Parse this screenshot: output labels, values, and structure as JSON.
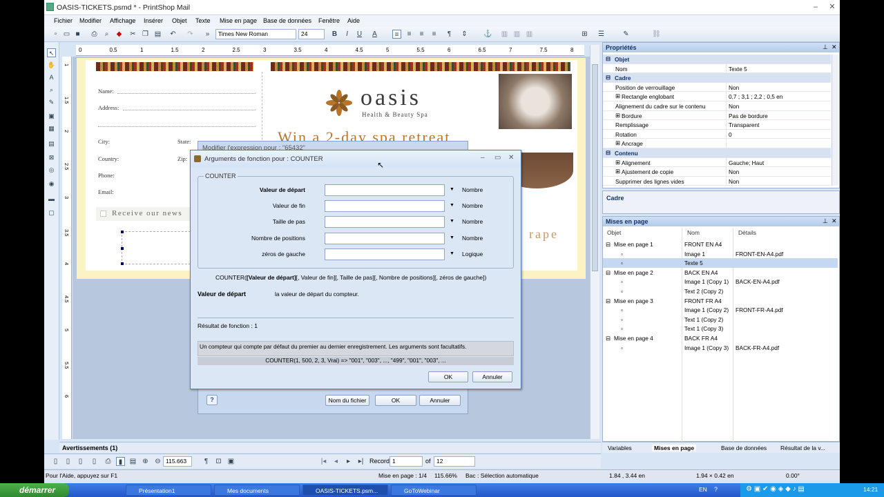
{
  "window": {
    "title": "OASIS-TICKETS.psmd * - PrintShop Mail"
  },
  "menu": [
    "Fichier",
    "Modifier",
    "Affichage",
    "Insérer",
    "Objet",
    "Texte",
    "Mise en page",
    "Base de données",
    "Fenêtre",
    "Aide"
  ],
  "toolbar": {
    "font": "Times New Roman",
    "size": "24",
    "zoom": "115.663"
  },
  "ruler": {
    "h_ticks": [
      "0",
      "0.5",
      "1",
      "1.5",
      "2",
      "2.5",
      "3",
      "3.5",
      "4",
      "4.5",
      "5",
      "5.5",
      "6",
      "6.5",
      "7",
      "7.5",
      "8"
    ],
    "v_ticks": [
      "1",
      "1.5",
      "2",
      "2.5",
      "3",
      "3.5",
      "4",
      "4.5",
      "5",
      "5.5",
      "6"
    ]
  },
  "document": {
    "form": {
      "name": "Name:",
      "address": "Address:",
      "city": "City:",
      "state": "State:",
      "country": "Country:",
      "zip": "Zip:",
      "phone": "Phone:",
      "email": "Email:",
      "receive": "Receive our news"
    },
    "brand": {
      "name": "oasis",
      "tagline": "Health & Beauty Spa",
      "headline": "Win a 2-day spa retreat",
      "fragment": "rape"
    }
  },
  "dialog_back": {
    "title": "Modifier l'expression pour : \"65432\"",
    "help_label": "?",
    "file_button": "Nom du fichier",
    "ok": "OK",
    "cancel": "Annuler"
  },
  "dialog": {
    "title": "Arguments de fonction pour : COUNTER",
    "group": "COUNTER",
    "fields": [
      {
        "label": "Valeur de départ",
        "type": "Nombre",
        "bold": true
      },
      {
        "label": "Valeur de fin",
        "type": "Nombre"
      },
      {
        "label": "Taille de pas",
        "type": "Nombre"
      },
      {
        "label": "Nombre de positions",
        "type": "Nombre"
      },
      {
        "label": "zéros de gauche",
        "type": "Logique"
      }
    ],
    "syntax_prefix": "COUNTER(",
    "syntax_bold": "[Valeur de départ]",
    "syntax_rest": "[, Valeur de fin][, Taille de pas][, Nombre de positions][, zéros de gauche])",
    "arg_name": "Valeur de départ",
    "arg_desc": "la valeur de départ du compteur.",
    "result": "Résultat de fonction : 1",
    "description": "Un compteur qui compte par défaut du premier au dernier enregistrement. Les arguments sont facultatifs.",
    "example": "COUNTER(1, 500, 2, 3, Vrai) => \"001\", \"003\", ..., \"499\", \"001\", \"003\", ...",
    "ok": "OK",
    "cancel": "Annuler"
  },
  "properties": {
    "title": "Propriétés",
    "rows": [
      {
        "k": "Objet",
        "v": "",
        "grp": true
      },
      {
        "k": "Nom",
        "v": "Texte 5"
      },
      {
        "k": "Cadre",
        "v": "",
        "grp": true
      },
      {
        "k": "Position de verrouillage",
        "v": "Non"
      },
      {
        "k": "Rectangle englobant",
        "v": "0,7 ; 3,1 ; 2,2 ; 0,5 en",
        "exp": true
      },
      {
        "k": "Alignement du cadre sur le contenu",
        "v": "Non"
      },
      {
        "k": "Bordure",
        "v": "Pas de bordure",
        "exp": true
      },
      {
        "k": "Remplissage",
        "v": "Transparent"
      },
      {
        "k": "Rotation",
        "v": "0"
      },
      {
        "k": "Ancrage",
        "v": "",
        "exp": true
      },
      {
        "k": "Contenu",
        "v": "",
        "grp": true
      },
      {
        "k": "Alignement",
        "v": "Gauche; Haut",
        "exp": true
      },
      {
        "k": "Ajustement de copie",
        "v": "Non",
        "exp": true
      },
      {
        "k": "Supprimer des lignes vides",
        "v": "Non"
      }
    ],
    "footer": "Cadre"
  },
  "mises": {
    "title": "Mises en page",
    "headers": [
      "Objet",
      "Nom",
      "Détails"
    ],
    "rows": [
      {
        "o": "Mise en page 1",
        "n": "FRONT EN A4",
        "d": "",
        "lvl": 0
      },
      {
        "o": "",
        "n": "Image 1",
        "d": "FRONT-EN-A4.pdf",
        "lvl": 1
      },
      {
        "o": "",
        "n": "Texte 5",
        "d": "",
        "lvl": 1,
        "sel": true
      },
      {
        "o": "Mise en page 2",
        "n": "BACK EN A4",
        "d": "",
        "lvl": 0
      },
      {
        "o": "",
        "n": "Image 1 (Copy 1)",
        "d": "BACK-EN-A4.pdf",
        "lvl": 1
      },
      {
        "o": "",
        "n": "Text 2 (Copy 2)",
        "d": "",
        "lvl": 1
      },
      {
        "o": "Mise en page 3",
        "n": "FRONT FR A4",
        "d": "",
        "lvl": 0
      },
      {
        "o": "",
        "n": "Image 1 (Copy 2)",
        "d": "FRONT-FR-A4.pdf",
        "lvl": 1
      },
      {
        "o": "",
        "n": "Text 1 (Copy 2)",
        "d": "",
        "lvl": 1
      },
      {
        "o": "",
        "n": "Text 1 (Copy 3)",
        "d": "",
        "lvl": 1
      },
      {
        "o": "Mise en page 4",
        "n": "BACK FR A4",
        "d": "",
        "lvl": 0
      },
      {
        "o": "",
        "n": "Image 1 (Copy 3)",
        "d": "BACK-FR-A4.pdf",
        "lvl": 1
      }
    ]
  },
  "bottom_tabs": [
    "Variables",
    "Mises en page",
    "Base de données",
    "Résultat de la v..."
  ],
  "warnings": "Avertissements (1)",
  "nav": {
    "record_label": "Record",
    "record": "1",
    "of_label": "of",
    "total": "12"
  },
  "status": {
    "help": "Pour l'Aide, appuyez sur F1",
    "page": "Mise en page : 1/4",
    "zoom": "115.66%",
    "mode": "Bac : Sélection automatique",
    "pos": "1.84 , 3.44 en",
    "size": "1.94 × 0.42 en",
    "angle": "0.00°"
  },
  "taskbar": {
    "start": "démarrer",
    "tasks": [
      "Présentation1",
      "Mes documents",
      "OASIS-TICKETS.psm...",
      "GoToWebinar"
    ],
    "lang": "EN",
    "time": "14:21"
  }
}
